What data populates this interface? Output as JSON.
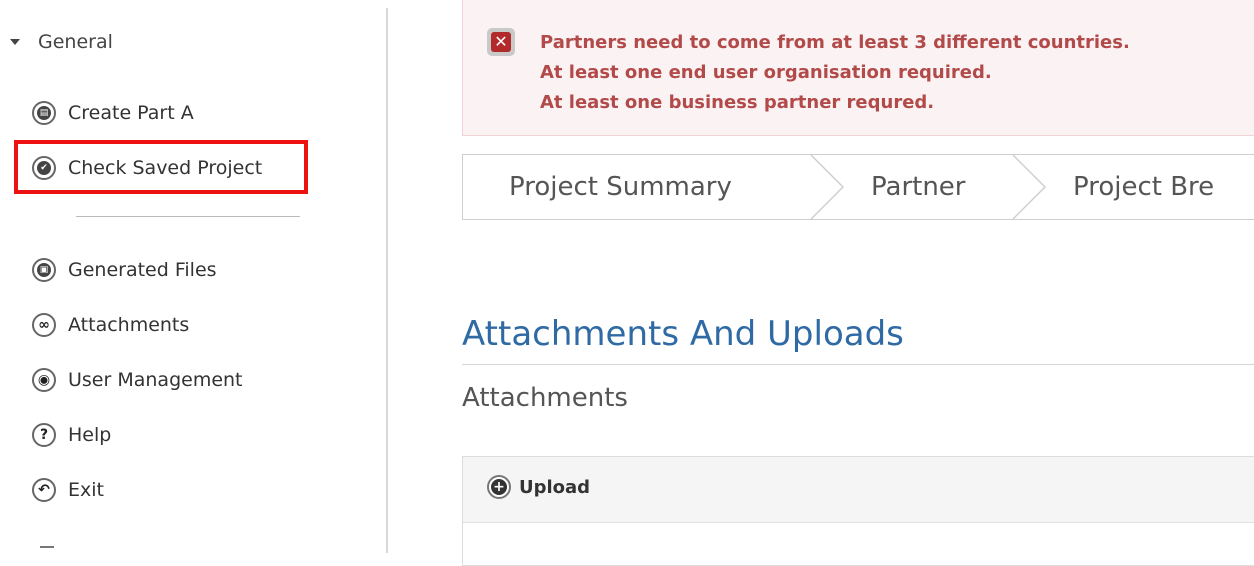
{
  "sidebar": {
    "section_label": "General",
    "items": [
      {
        "label": "Create Part A",
        "icon": "print-icon"
      },
      {
        "label": "Check Saved Project",
        "icon": "check-icon"
      },
      {
        "label": "Generated Files",
        "icon": "save-icon"
      },
      {
        "label": "Attachments",
        "icon": "link-icon"
      },
      {
        "label": "User Management",
        "icon": "user-icon"
      },
      {
        "label": "Help",
        "icon": "help-icon"
      },
      {
        "label": "Exit",
        "icon": "exit-icon"
      }
    ]
  },
  "errors": {
    "messages": [
      "Partners need to come from at least 3 different countries.",
      "At least one end user organisation required.",
      "At least one business partner requred."
    ],
    "icon": "error-x-icon",
    "color": "#b24a4a"
  },
  "steps": [
    "Project Summary",
    "Partner",
    "Project Bre"
  ],
  "page": {
    "title": "Attachments And Uploads",
    "subtitle": "Attachments",
    "upload_label": "Upload"
  },
  "colors": {
    "title": "#2f6aa5",
    "highlight": "#ee1111"
  }
}
